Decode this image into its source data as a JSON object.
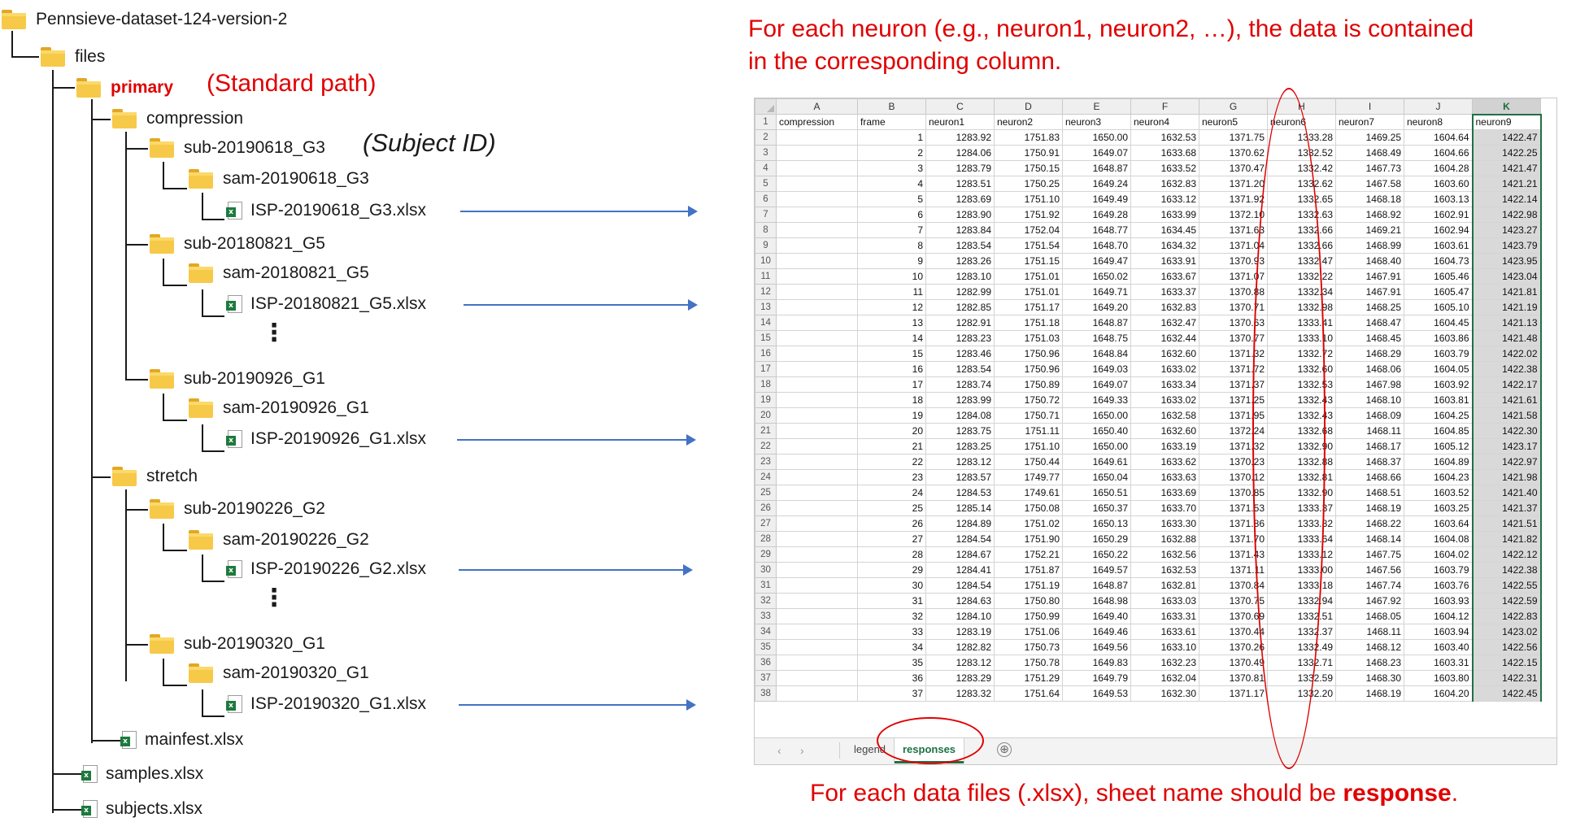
{
  "tree": {
    "root": "Pennsieve-dataset-124-version-2",
    "files": "files",
    "primary": "primary",
    "primary_annotation": "(Standard path)",
    "subject_annotation": "(Subject ID)",
    "compression": "compression",
    "stretch": "stretch",
    "sub1": "sub-20190618_G3",
    "sam1": "sam-20190618_G3",
    "file1": "ISP-20190618_G3.xlsx",
    "sub2": "sub-20180821_G5",
    "sam2": "sam-20180821_G5",
    "file2": "ISP-20180821_G5.xlsx",
    "sub3": "sub-20190926_G1",
    "sam3": "sam-20190926_G1",
    "file3": "ISP-20190926_G1.xlsx",
    "sub4": "sub-20190226_G2",
    "sam4": "sam-20190226_G2",
    "file4": "ISP-20190226_G2.xlsx",
    "sub5": "sub-20190320_G1",
    "sam5": "sam-20190320_G1",
    "file5": "ISP-20190320_G1.xlsx",
    "manifest": "mainfest.xlsx",
    "samples": "samples.xlsx",
    "subjects": "subjects.xlsx",
    "ellipsis": "⋮"
  },
  "notes": {
    "top_line1": "For each neuron (e.g., neuron1, neuron2, …), the data is contained",
    "top_line2": "in the corresponding column.",
    "bottom_prefix": "For each data files (.xlsx), sheet name should be ",
    "bottom_bold": "response",
    "bottom_suffix": "."
  },
  "sheet": {
    "columns": [
      "A",
      "B",
      "C",
      "D",
      "E",
      "F",
      "G",
      "H",
      "I",
      "J",
      "K"
    ],
    "selected_column": "K",
    "header": [
      "compression",
      "frame",
      "neuron1",
      "neuron2",
      "neuron3",
      "neuron4",
      "neuron5",
      "neuron6",
      "neuron7",
      "neuron8",
      "neuron9"
    ],
    "rows": [
      [
        "",
        1,
        "1283.92",
        "1751.83",
        "1650.00",
        "1632.53",
        "1371.75",
        "1333.28",
        "1469.25",
        "1604.64",
        "1422.47"
      ],
      [
        "",
        2,
        "1284.06",
        "1750.91",
        "1649.07",
        "1633.68",
        "1370.62",
        "1332.52",
        "1468.49",
        "1604.66",
        "1422.25"
      ],
      [
        "",
        3,
        "1283.79",
        "1750.15",
        "1648.87",
        "1633.52",
        "1370.47",
        "1332.42",
        "1467.73",
        "1604.28",
        "1421.47"
      ],
      [
        "",
        4,
        "1283.51",
        "1750.25",
        "1649.24",
        "1632.83",
        "1371.20",
        "1332.62",
        "1467.58",
        "1603.60",
        "1421.21"
      ],
      [
        "",
        5,
        "1283.69",
        "1751.10",
        "1649.49",
        "1633.12",
        "1371.92",
        "1332.65",
        "1468.18",
        "1603.13",
        "1422.14"
      ],
      [
        "",
        6,
        "1283.90",
        "1751.92",
        "1649.28",
        "1633.99",
        "1372.10",
        "1332.63",
        "1468.92",
        "1602.91",
        "1422.98"
      ],
      [
        "",
        7,
        "1283.84",
        "1752.04",
        "1648.77",
        "1634.45",
        "1371.63",
        "1332.66",
        "1469.21",
        "1602.94",
        "1423.27"
      ],
      [
        "",
        8,
        "1283.54",
        "1751.54",
        "1648.70",
        "1634.32",
        "1371.04",
        "1332.66",
        "1468.99",
        "1603.61",
        "1423.79"
      ],
      [
        "",
        9,
        "1283.26",
        "1751.15",
        "1649.47",
        "1633.91",
        "1370.93",
        "1332.47",
        "1468.40",
        "1604.73",
        "1423.95"
      ],
      [
        "",
        10,
        "1283.10",
        "1751.01",
        "1650.02",
        "1633.67",
        "1371.07",
        "1332.22",
        "1467.91",
        "1605.46",
        "1423.04"
      ],
      [
        "",
        11,
        "1282.99",
        "1751.01",
        "1649.71",
        "1633.37",
        "1370.88",
        "1332.34",
        "1467.91",
        "1605.47",
        "1421.81"
      ],
      [
        "",
        12,
        "1282.85",
        "1751.17",
        "1649.20",
        "1632.83",
        "1370.71",
        "1332.98",
        "1468.25",
        "1605.10",
        "1421.19"
      ],
      [
        "",
        13,
        "1282.91",
        "1751.18",
        "1648.87",
        "1632.47",
        "1370.63",
        "1333.41",
        "1468.47",
        "1604.45",
        "1421.13"
      ],
      [
        "",
        14,
        "1283.23",
        "1751.03",
        "1648.75",
        "1632.44",
        "1370.77",
        "1333.10",
        "1468.45",
        "1603.86",
        "1421.48"
      ],
      [
        "",
        15,
        "1283.46",
        "1750.96",
        "1648.84",
        "1632.60",
        "1371.32",
        "1332.72",
        "1468.29",
        "1603.79",
        "1422.02"
      ],
      [
        "",
        16,
        "1283.54",
        "1750.96",
        "1649.03",
        "1633.02",
        "1371.72",
        "1332.60",
        "1468.06",
        "1604.05",
        "1422.38"
      ],
      [
        "",
        17,
        "1283.74",
        "1750.89",
        "1649.07",
        "1633.34",
        "1371.37",
        "1332.53",
        "1467.98",
        "1603.92",
        "1422.17"
      ],
      [
        "",
        18,
        "1283.99",
        "1750.72",
        "1649.33",
        "1633.02",
        "1371.25",
        "1332.43",
        "1468.10",
        "1603.81",
        "1421.61"
      ],
      [
        "",
        19,
        "1284.08",
        "1750.71",
        "1650.00",
        "1632.58",
        "1371.95",
        "1332.43",
        "1468.09",
        "1604.25",
        "1421.58"
      ],
      [
        "",
        20,
        "1283.75",
        "1751.11",
        "1650.40",
        "1632.60",
        "1372.24",
        "1332.68",
        "1468.11",
        "1604.85",
        "1422.30"
      ],
      [
        "",
        21,
        "1283.25",
        "1751.10",
        "1650.00",
        "1633.19",
        "1371.32",
        "1332.90",
        "1468.17",
        "1605.12",
        "1423.17"
      ],
      [
        "",
        22,
        "1283.12",
        "1750.44",
        "1649.61",
        "1633.62",
        "1370.23",
        "1332.88",
        "1468.37",
        "1604.89",
        "1422.97"
      ],
      [
        "",
        23,
        "1283.57",
        "1749.77",
        "1650.04",
        "1633.63",
        "1370.12",
        "1332.81",
        "1468.66",
        "1604.23",
        "1421.98"
      ],
      [
        "",
        24,
        "1284.53",
        "1749.61",
        "1650.51",
        "1633.69",
        "1370.85",
        "1332.90",
        "1468.51",
        "1603.52",
        "1421.40"
      ],
      [
        "",
        25,
        "1285.14",
        "1750.08",
        "1650.37",
        "1633.70",
        "1371.53",
        "1333.37",
        "1468.19",
        "1603.25",
        "1421.37"
      ],
      [
        "",
        26,
        "1284.89",
        "1751.02",
        "1650.13",
        "1633.30",
        "1371.86",
        "1333.82",
        "1468.22",
        "1603.64",
        "1421.51"
      ],
      [
        "",
        27,
        "1284.54",
        "1751.90",
        "1650.29",
        "1632.88",
        "1371.70",
        "1333.64",
        "1468.14",
        "1604.08",
        "1421.82"
      ],
      [
        "",
        28,
        "1284.67",
        "1752.21",
        "1650.22",
        "1632.56",
        "1371.43",
        "1333.12",
        "1467.75",
        "1604.02",
        "1422.12"
      ],
      [
        "",
        29,
        "1284.41",
        "1751.87",
        "1649.57",
        "1632.53",
        "1371.11",
        "1333.00",
        "1467.56",
        "1603.79",
        "1422.38"
      ],
      [
        "",
        30,
        "1284.54",
        "1751.19",
        "1648.87",
        "1632.81",
        "1370.84",
        "1333.18",
        "1467.74",
        "1603.76",
        "1422.55"
      ],
      [
        "",
        31,
        "1284.63",
        "1750.80",
        "1648.98",
        "1633.03",
        "1370.75",
        "1332.94",
        "1467.92",
        "1603.93",
        "1422.59"
      ],
      [
        "",
        32,
        "1284.10",
        "1750.99",
        "1649.40",
        "1633.31",
        "1370.69",
        "1332.51",
        "1468.05",
        "1604.12",
        "1422.83"
      ],
      [
        "",
        33,
        "1283.19",
        "1751.06",
        "1649.46",
        "1633.61",
        "1370.44",
        "1332.37",
        "1468.11",
        "1603.94",
        "1423.02"
      ],
      [
        "",
        34,
        "1282.82",
        "1750.73",
        "1649.56",
        "1633.10",
        "1370.26",
        "1332.49",
        "1468.12",
        "1603.40",
        "1422.56"
      ],
      [
        "",
        35,
        "1283.12",
        "1750.78",
        "1649.83",
        "1632.23",
        "1370.49",
        "1332.71",
        "1468.23",
        "1603.31",
        "1422.15"
      ],
      [
        "",
        36,
        "1283.29",
        "1751.29",
        "1649.79",
        "1632.04",
        "1370.81",
        "1332.59",
        "1468.30",
        "1603.80",
        "1422.31"
      ],
      [
        "",
        37,
        "1283.32",
        "1751.64",
        "1649.53",
        "1632.30",
        "1371.17",
        "1332.20",
        "1468.19",
        "1604.20",
        "1422.45"
      ]
    ],
    "tabs": [
      {
        "label": "legend",
        "active": false
      },
      {
        "label": "responses",
        "active": true
      }
    ],
    "add_sheet": "⊕",
    "nav_prev": "‹",
    "nav_next": "›"
  },
  "colors": {
    "annotation_red": "#e00000",
    "excel_green": "#1e7145",
    "arrow_blue": "#4472c4",
    "folder_yellow": "#f7c948"
  },
  "icons": {
    "folder": "folder-icon",
    "excel_file": "excel-file-icon",
    "arrow": "arrow-right-icon"
  }
}
